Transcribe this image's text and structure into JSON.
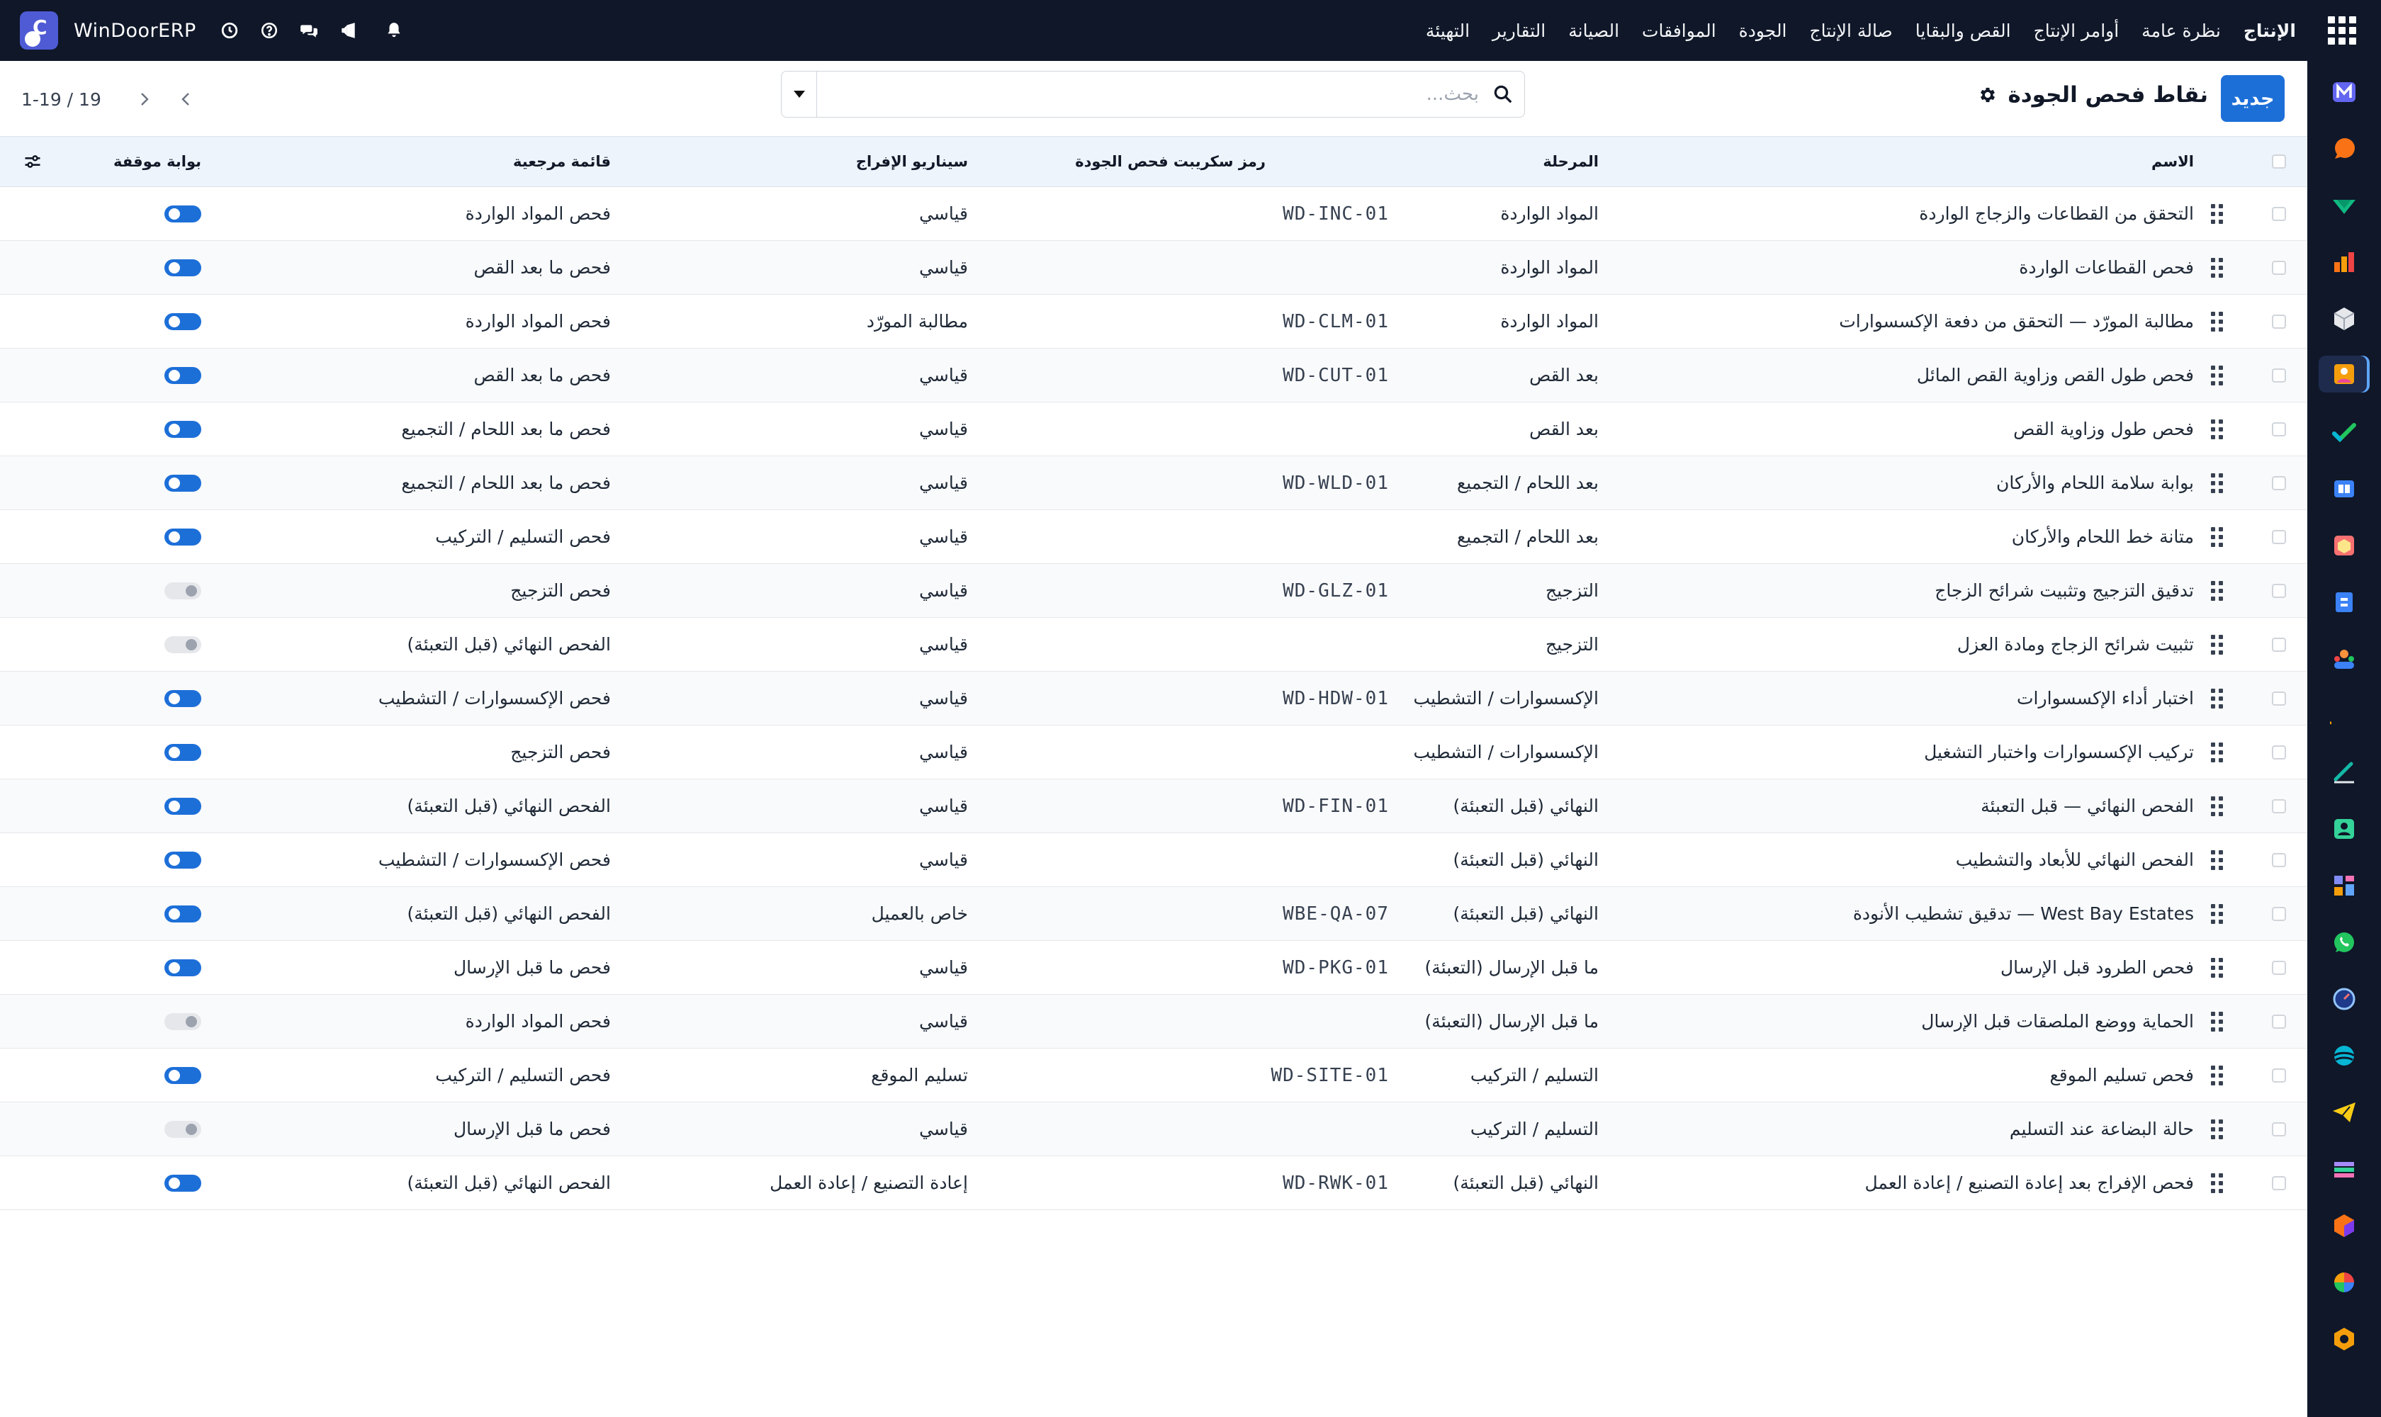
{
  "app": {
    "brand": "WinDoorERP",
    "brand_initial": "C",
    "menu": [
      "الإنتاج",
      "نظرة عامة",
      "أوامر الإنتاج",
      "القص والبقايا",
      "صالة الإنتاج",
      "الجودة",
      "الموافقات",
      "الصيانة",
      "التقارير",
      "التهيئة"
    ]
  },
  "control_panel": {
    "new_label": "جديد",
    "title": "نقاط فحص الجودة",
    "search_placeholder": "بحث...",
    "pager": "1-19 / 19"
  },
  "table": {
    "headers": {
      "name": "الاسم",
      "stage": "المرحلة",
      "code": "رمز سكريبت فحص الجودة",
      "scenario": "سيناريو الإفراج",
      "checklist": "قائمة مرجعية",
      "gate": "بوابة موقفة"
    },
    "rows": [
      {
        "name": "التحقق من القطاعات والزجاج الواردة",
        "stage": "المواد الواردة",
        "code": "WD-INC-01",
        "scenario": "قياسي",
        "checklist": "فحص المواد الواردة",
        "gate": true
      },
      {
        "name": "فحص القطاعات الواردة",
        "stage": "المواد الواردة",
        "code": "",
        "scenario": "قياسي",
        "checklist": "فحص ما بعد القص",
        "gate": true
      },
      {
        "name": "مطالبة المورّد — التحقق من دفعة الإكسسوارات",
        "stage": "المواد الواردة",
        "code": "WD-CLM-01",
        "scenario": "مطالبة المورّد",
        "checklist": "فحص المواد الواردة",
        "gate": true
      },
      {
        "name": "فحص طول القص وزاوية القص المائل",
        "stage": "بعد القص",
        "code": "WD-CUT-01",
        "scenario": "قياسي",
        "checklist": "فحص ما بعد القص",
        "gate": true
      },
      {
        "name": "فحص طول وزاوية القص",
        "stage": "بعد القص",
        "code": "",
        "scenario": "قياسي",
        "checklist": "فحص ما بعد اللحام / التجميع",
        "gate": true
      },
      {
        "name": "بوابة سلامة اللحام والأركان",
        "stage": "بعد اللحام / التجميع",
        "code": "WD-WLD-01",
        "scenario": "قياسي",
        "checklist": "فحص ما بعد اللحام / التجميع",
        "gate": true
      },
      {
        "name": "متانة خط اللحام والأركان",
        "stage": "بعد اللحام / التجميع",
        "code": "",
        "scenario": "قياسي",
        "checklist": "فحص التسليم / التركيب",
        "gate": true
      },
      {
        "name": "تدقيق التزجيج وتثبيت شرائح الزجاج",
        "stage": "التزجيج",
        "code": "WD-GLZ-01",
        "scenario": "قياسي",
        "checklist": "فحص التزجيج",
        "gate": false
      },
      {
        "name": "تثبيت شرائح الزجاج ومادة العزل",
        "stage": "التزجيج",
        "code": "",
        "scenario": "قياسي",
        "checklist": "الفحص النهائي (قبل التعبئة)",
        "gate": false
      },
      {
        "name": "اختبار أداء الإكسسوارات",
        "stage": "الإكسسوارات / التشطيب",
        "code": "WD-HDW-01",
        "scenario": "قياسي",
        "checklist": "فحص الإكسسوارات / التشطيب",
        "gate": true
      },
      {
        "name": "تركيب الإكسسوارات واختبار التشغيل",
        "stage": "الإكسسوارات / التشطيب",
        "code": "",
        "scenario": "قياسي",
        "checklist": "فحص التزجيج",
        "gate": true
      },
      {
        "name": "الفحص النهائي — قبل التعبئة",
        "stage": "النهائي (قبل التعبئة)",
        "code": "WD-FIN-01",
        "scenario": "قياسي",
        "checklist": "الفحص النهائي (قبل التعبئة)",
        "gate": true
      },
      {
        "name": "الفحص النهائي للأبعاد والتشطيب",
        "stage": "النهائي (قبل التعبئة)",
        "code": "",
        "scenario": "قياسي",
        "checklist": "فحص الإكسسوارات / التشطيب",
        "gate": true
      },
      {
        "name": "West Bay Estates — تدقيق تشطيب الأنودة",
        "stage": "النهائي (قبل التعبئة)",
        "code": "WBE-QA-07",
        "scenario": "خاص بالعميل",
        "checklist": "الفحص النهائي (قبل التعبئة)",
        "gate": true
      },
      {
        "name": "فحص الطرود قبل الإرسال",
        "stage": "ما قبل الإرسال (التعبئة)",
        "code": "WD-PKG-01",
        "scenario": "قياسي",
        "checklist": "فحص ما قبل الإرسال",
        "gate": true
      },
      {
        "name": "الحماية ووضع الملصقات قبل الإرسال",
        "stage": "ما قبل الإرسال (التعبئة)",
        "code": "",
        "scenario": "قياسي",
        "checklist": "فحص المواد الواردة",
        "gate": false
      },
      {
        "name": "فحص تسليم الموقع",
        "stage": "التسليم / التركيب",
        "code": "WD-SITE-01",
        "scenario": "تسليم الموقع",
        "checklist": "فحص التسليم / التركيب",
        "gate": true
      },
      {
        "name": "حالة البضاعة عند التسليم",
        "stage": "التسليم / التركيب",
        "code": "",
        "scenario": "قياسي",
        "checklist": "فحص ما قبل الإرسال",
        "gate": false
      },
      {
        "name": "فحص الإفراج بعد إعادة التصنيع / إعادة العمل",
        "stage": "النهائي (قبل التعبئة)",
        "code": "WD-RWK-01",
        "scenario": "إعادة التصنيع / إعادة العمل",
        "checklist": "الفحص النهائي (قبل التعبئة)",
        "gate": true
      }
    ]
  },
  "rail_apps": [
    {
      "name": "mail-app-icon",
      "color": "#6366f1"
    },
    {
      "name": "discuss-app-icon",
      "color": "#f97316"
    },
    {
      "name": "crm-app-icon",
      "color": "#10b981"
    },
    {
      "name": "reports-app-icon",
      "color": "#f59e0b"
    },
    {
      "name": "inventory-app-icon",
      "color": "#e5e7eb"
    },
    {
      "name": "quality-app-icon",
      "color": "#f472b6"
    },
    {
      "name": "tasks-app-icon",
      "color": "#22c55e"
    },
    {
      "name": "knowledge-app-icon",
      "color": "#3b82f6"
    },
    {
      "name": "package-app-icon",
      "color": "#f87171"
    },
    {
      "name": "documents-app-icon",
      "color": "#60a5fa"
    },
    {
      "name": "employees-app-icon",
      "color": "#fb923c"
    },
    {
      "name": "calendar-app-icon",
      "color": "#f59e0b"
    },
    {
      "name": "sign-app-icon",
      "color": "#14b8a6"
    },
    {
      "name": "contacts-app-icon",
      "color": "#34d399"
    },
    {
      "name": "dashboard-app-icon",
      "color": "#818cf8"
    },
    {
      "name": "whatsapp-app-icon",
      "color": "#22c55e"
    },
    {
      "name": "timer-app-icon",
      "color": "#3b82f6"
    },
    {
      "name": "website-app-icon",
      "color": "#06b6d4"
    },
    {
      "name": "telegram-app-icon",
      "color": "#facc15"
    },
    {
      "name": "layers-app-icon",
      "color": "#a78bfa"
    },
    {
      "name": "cube-app-icon",
      "color": "#f97316"
    },
    {
      "name": "pie-app-icon",
      "color": "#ef4444"
    },
    {
      "name": "hexagon-app-icon",
      "color": "#f59e0b"
    }
  ]
}
